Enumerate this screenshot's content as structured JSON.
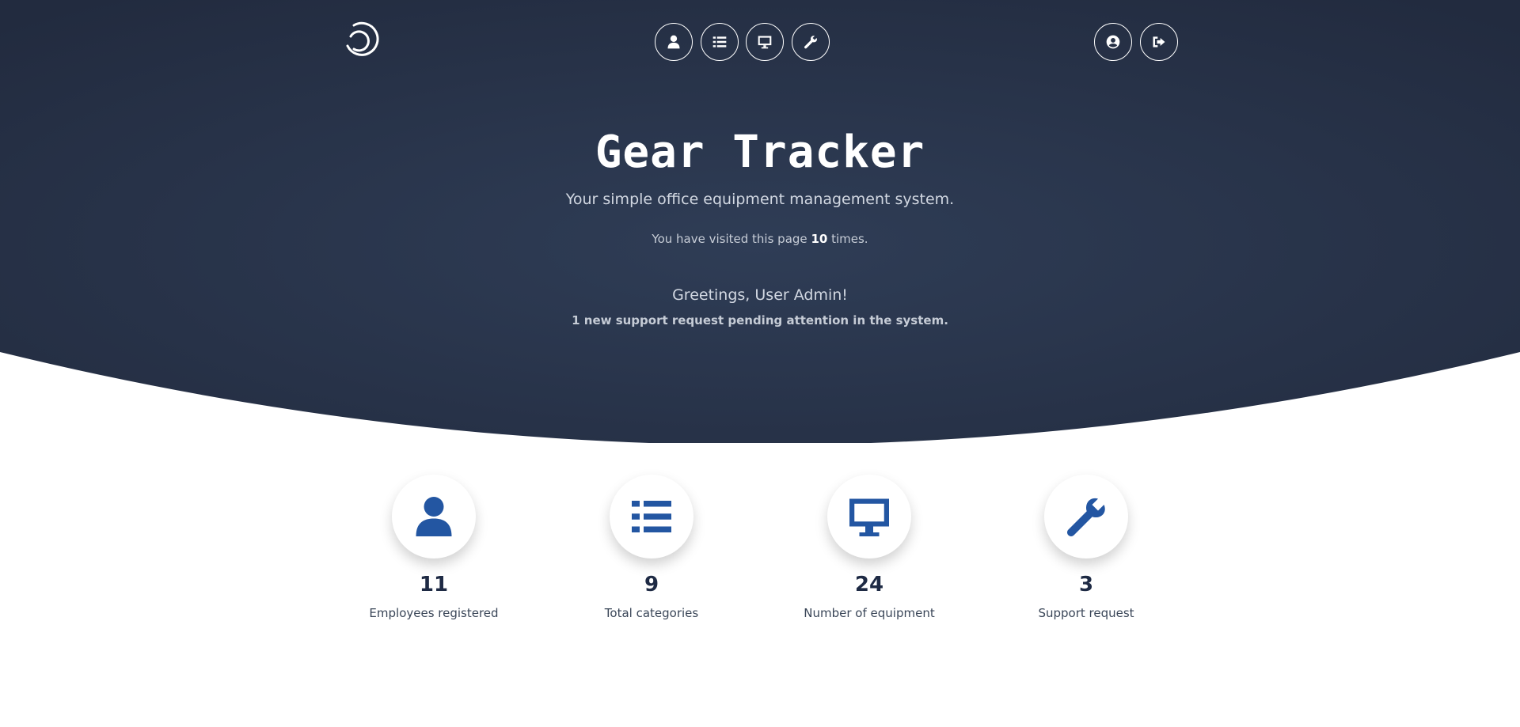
{
  "header": {
    "logo_icon": "power-swirl-icon",
    "nav": [
      {
        "name": "nav-employees-button",
        "icon": "user-icon"
      },
      {
        "name": "nav-categories-button",
        "icon": "list-icon"
      },
      {
        "name": "nav-equipment-button",
        "icon": "monitor-icon"
      },
      {
        "name": "nav-support-button",
        "icon": "wrench-icon"
      }
    ],
    "right_nav": [
      {
        "name": "profile-button",
        "icon": "user-circle-icon"
      },
      {
        "name": "logout-button",
        "icon": "sign-out-icon"
      }
    ]
  },
  "hero": {
    "title": "Gear Tracker",
    "subtitle": "Your simple office equipment management system.",
    "visits_prefix": "You have visited this page",
    "visits_count": "10",
    "visits_suffix": "times.",
    "greeting": "Greetings, User Admin!",
    "pending": "1 new support request pending attention in the system."
  },
  "stats": [
    {
      "icon": "user-icon",
      "value": "11",
      "label": "Employees registered"
    },
    {
      "icon": "list-icon",
      "value": "9",
      "label": "Total categories"
    },
    {
      "icon": "monitor-icon",
      "value": "24",
      "label": "Number of equipment"
    },
    {
      "icon": "wrench-icon",
      "value": "3",
      "label": "Support request"
    }
  ],
  "colors": {
    "hero_dark": "#232c40",
    "hero_mid": "#2d3a52",
    "accent": "#2356a2",
    "stat_value": "#1e2a44"
  }
}
